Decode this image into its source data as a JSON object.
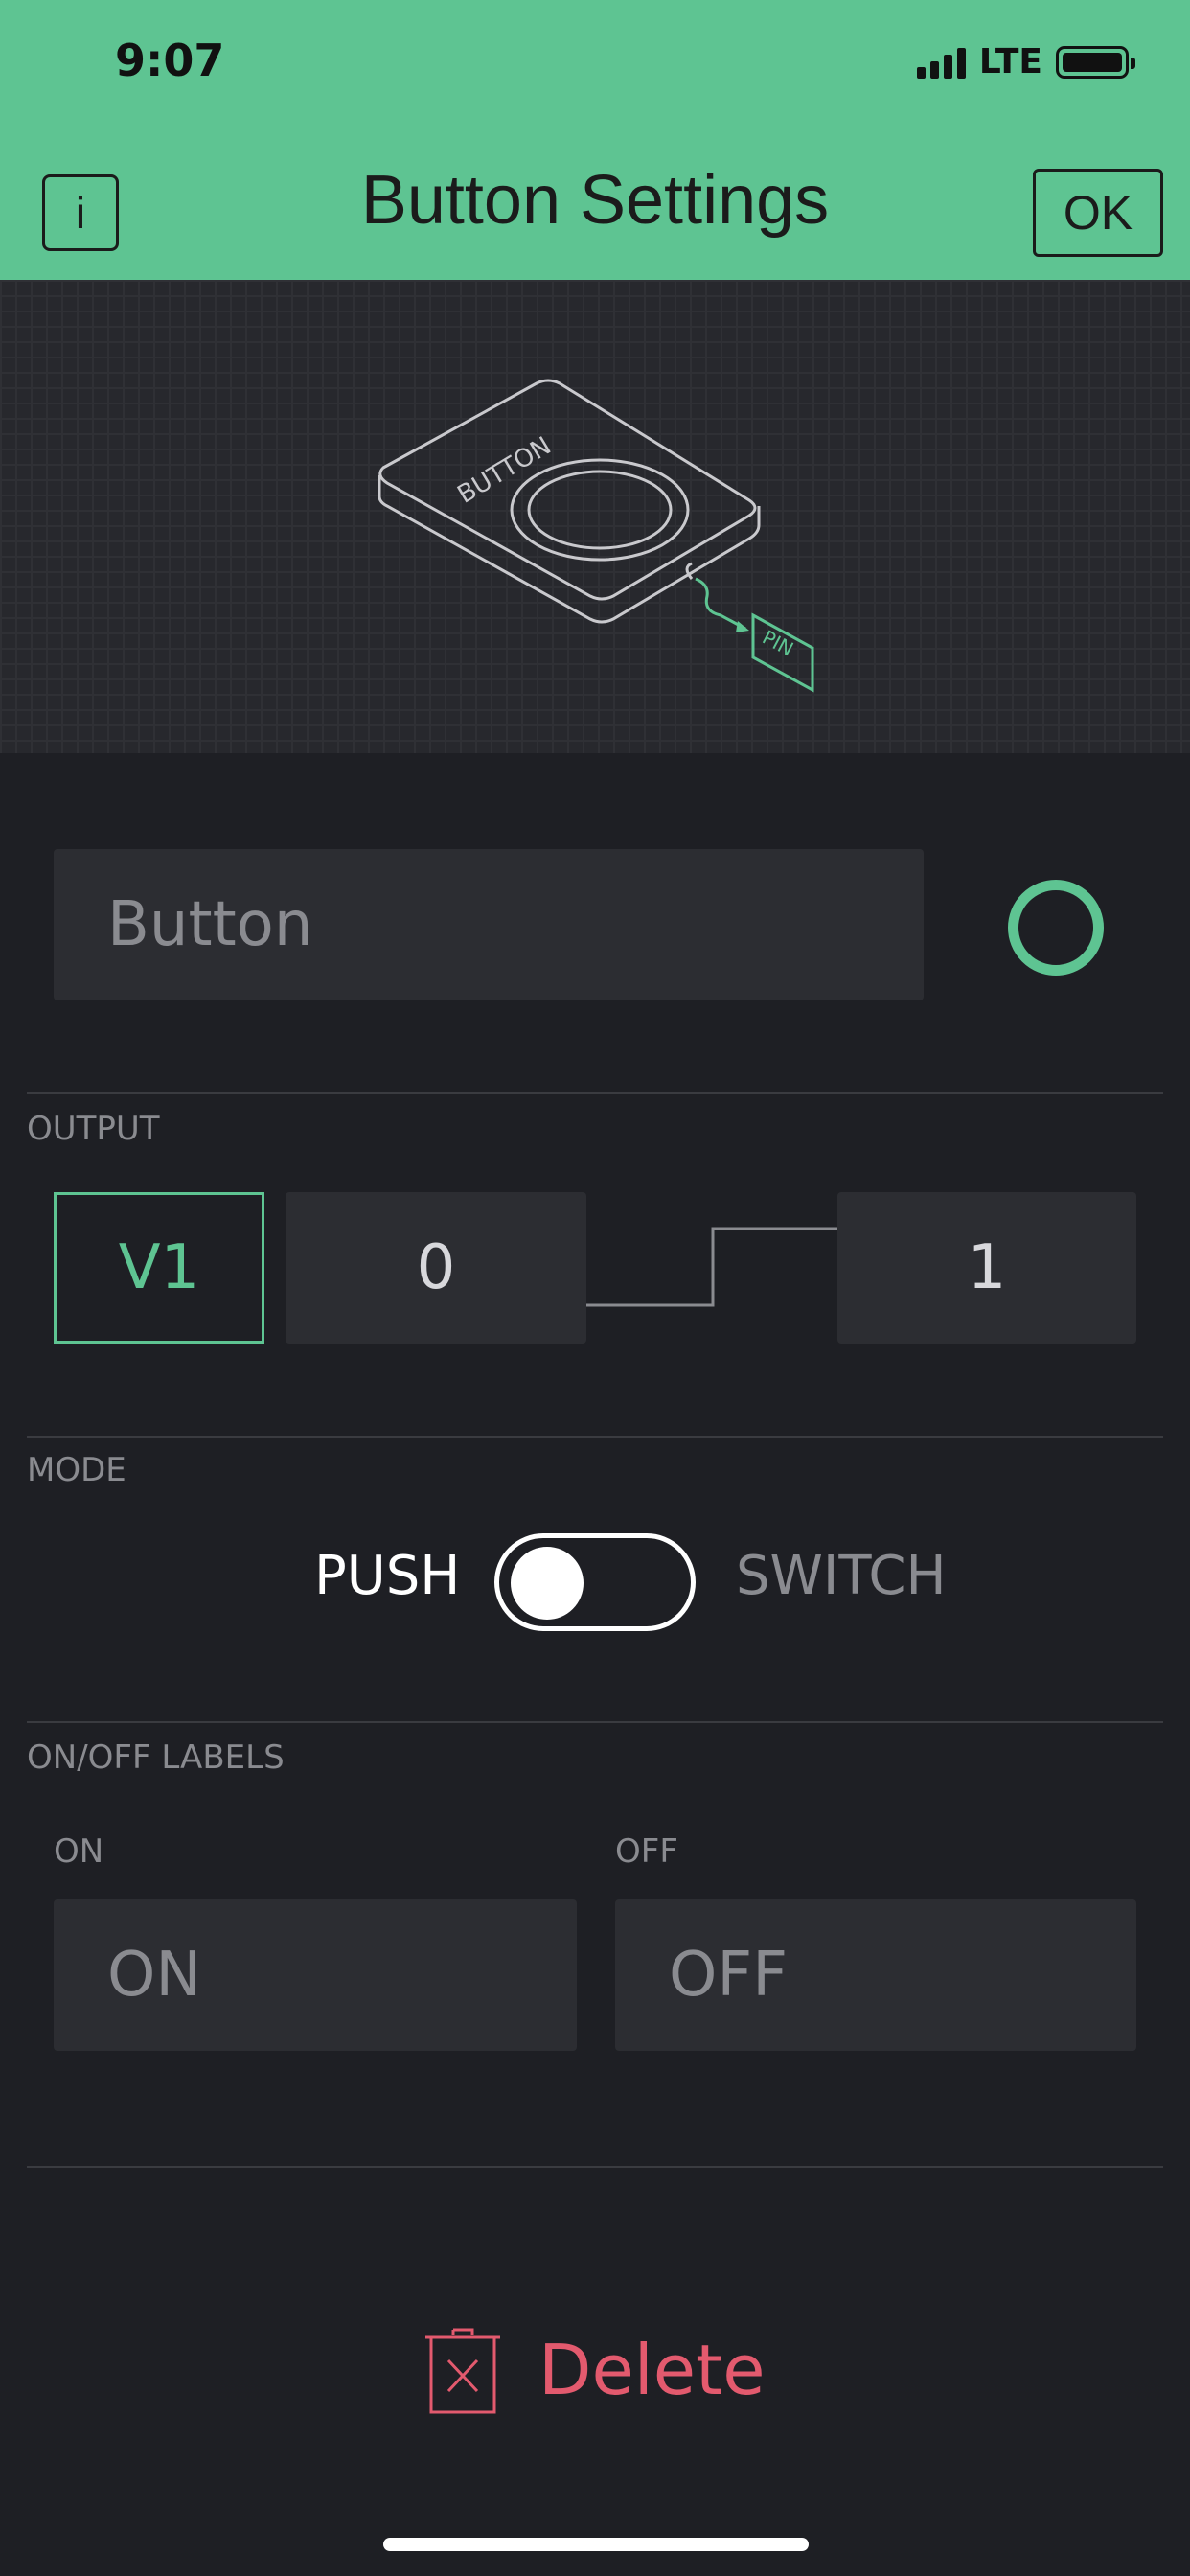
{
  "status_bar": {
    "time": "9:07",
    "network": "LTE"
  },
  "header": {
    "title": "Button Settings",
    "info_label": "i",
    "ok_label": "OK"
  },
  "illustration": {
    "device_label": "BUTTON",
    "pin_label": "PIN"
  },
  "widget": {
    "name_placeholder": "Button",
    "color": "#5ec492"
  },
  "output": {
    "section_label": "OUTPUT",
    "pin": "V1",
    "min_value": "0",
    "max_value": "1"
  },
  "mode": {
    "section_label": "MODE",
    "push_label": "PUSH",
    "switch_label": "SWITCH",
    "selected": "PUSH"
  },
  "labels": {
    "section_label": "ON/OFF LABELS",
    "on_caption": "ON",
    "off_caption": "OFF",
    "on_placeholder": "ON",
    "off_placeholder": "OFF"
  },
  "actions": {
    "delete_label": "Delete"
  },
  "colors": {
    "accent": "#5ec492",
    "danger": "#e35a6e",
    "background": "#1e1f24"
  }
}
